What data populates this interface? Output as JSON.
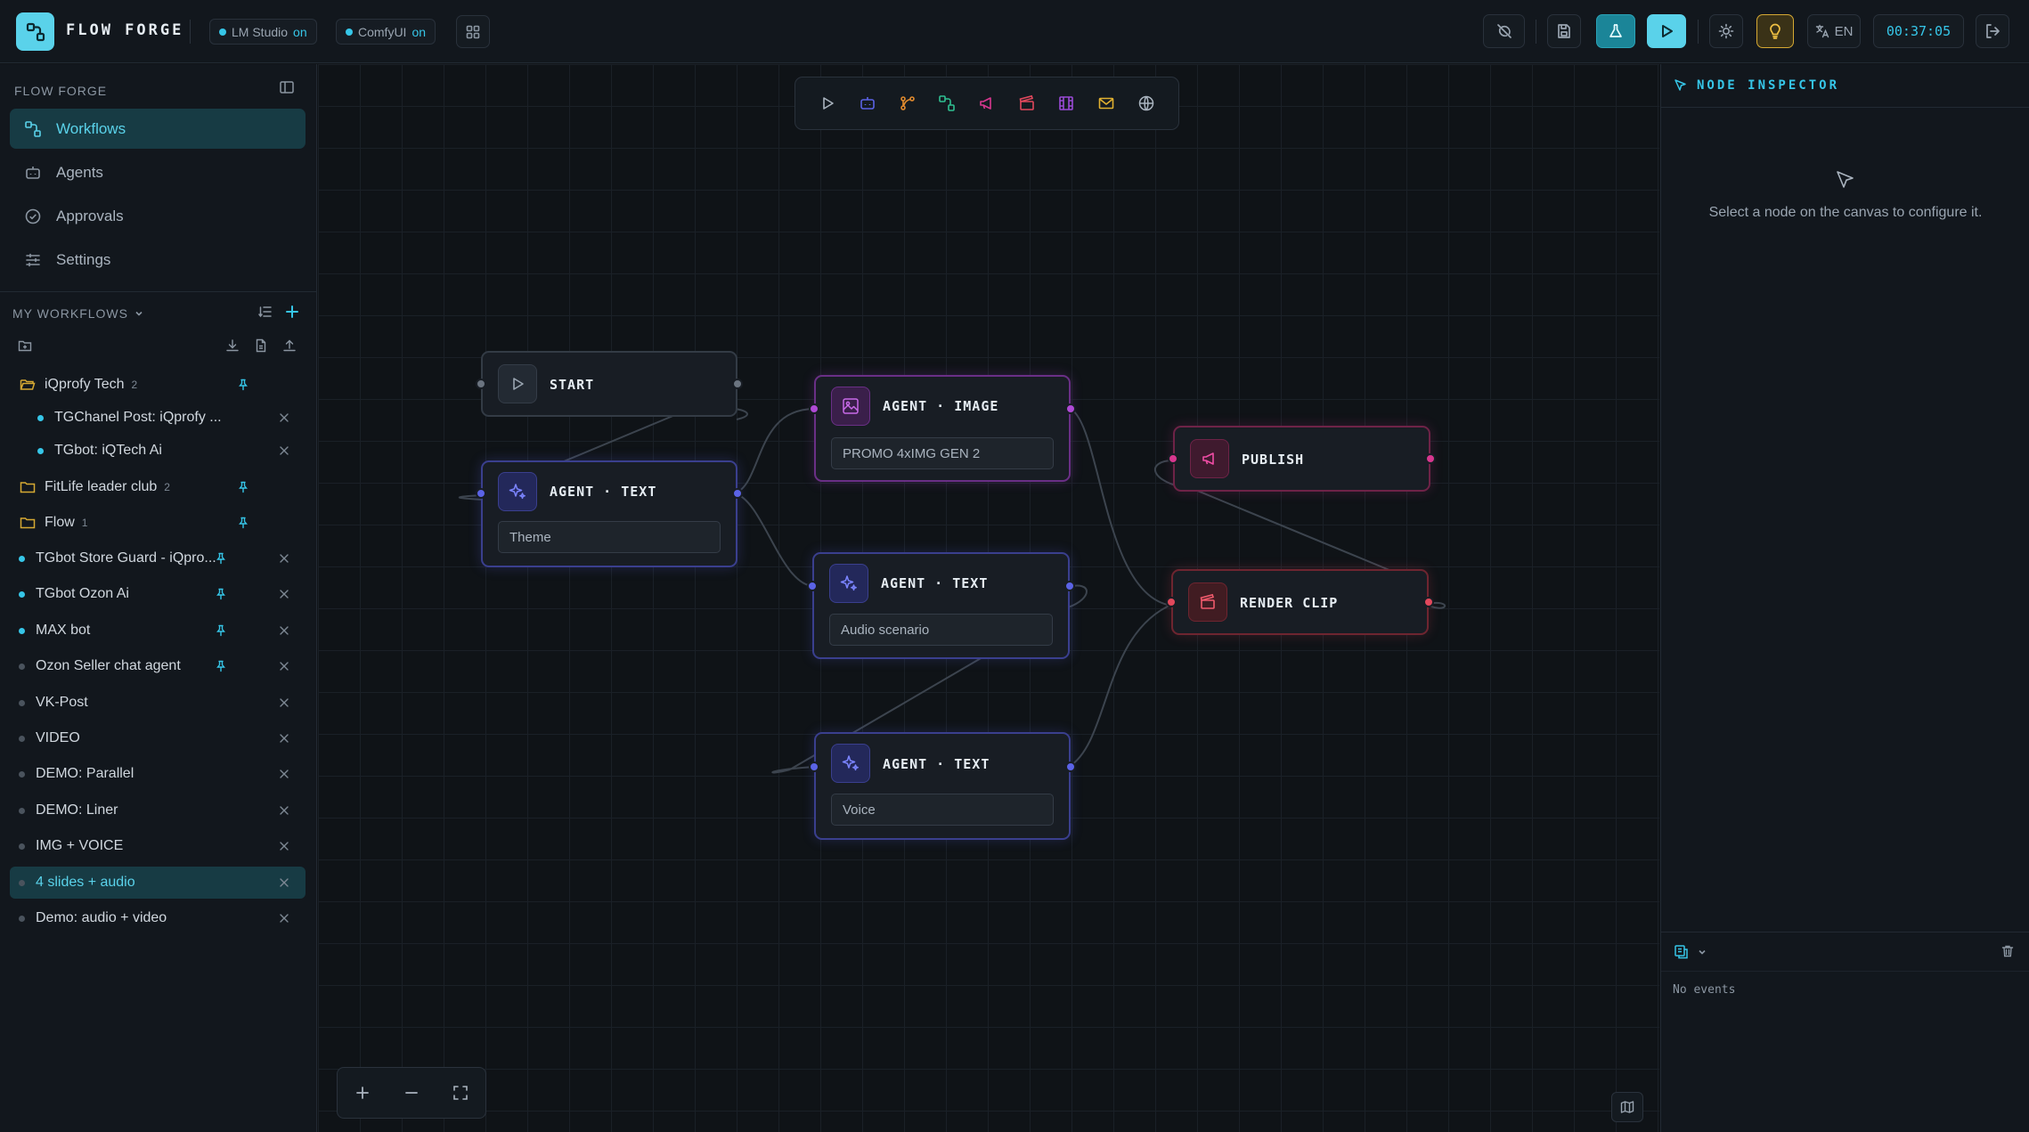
{
  "app": {
    "name": "FLOW FORGE"
  },
  "services": [
    {
      "name": "LM Studio",
      "status": "on"
    },
    {
      "name": "ComfyUI",
      "status": "on"
    }
  ],
  "header": {
    "language": "EN",
    "timer": "00:37:05"
  },
  "sidebar": {
    "heading": "FLOW FORGE",
    "nav": [
      {
        "label": "Workflows",
        "icon": "workflow-icon",
        "active": true
      },
      {
        "label": "Agents",
        "icon": "robot-icon",
        "active": false
      },
      {
        "label": "Approvals",
        "icon": "check-circle-icon",
        "active": false
      },
      {
        "label": "Settings",
        "icon": "sliders-icon",
        "active": false
      }
    ],
    "section_title": "MY WORKFLOWS",
    "folders": [
      {
        "name": "iQprofy Tech",
        "count": "2",
        "children": [
          "TGChanel Post: iQprofy ...",
          "TGbot: iQTech Ai"
        ]
      },
      {
        "name": "FitLife leader club",
        "count": "2"
      },
      {
        "name": "Flow",
        "count": "1"
      }
    ],
    "workflows": [
      {
        "name": "TGbot Store Guard - iQpro...",
        "active": true,
        "pinned": true
      },
      {
        "name": "TGbot Ozon Ai",
        "active": true,
        "pinned": true
      },
      {
        "name": "MAX bot",
        "active": true,
        "pinned": true
      },
      {
        "name": "Ozon Seller chat agent",
        "active": false,
        "pinned": true
      },
      {
        "name": "VK-Post",
        "active": false,
        "pinned": false
      },
      {
        "name": "VIDEO",
        "active": false,
        "pinned": false
      },
      {
        "name": "DEMO: Parallel",
        "active": false,
        "pinned": false
      },
      {
        "name": "DEMO: Liner",
        "active": false,
        "pinned": false
      },
      {
        "name": "IMG + VOICE",
        "active": false,
        "pinned": false
      },
      {
        "name": "4 slides + audio",
        "active": false,
        "pinned": false,
        "selected": true
      },
      {
        "name": "Demo: audio + video",
        "active": false,
        "pinned": false
      }
    ]
  },
  "canvas": {
    "palette": [
      "play-icon",
      "robot-icon",
      "branch-icon",
      "workflow-icon",
      "megaphone-icon",
      "clapperboard-icon",
      "film-icon",
      "mail-icon",
      "globe-icon"
    ],
    "nodes": {
      "start": {
        "title": "START"
      },
      "text_theme": {
        "title": "AGENT · TEXT",
        "field": "Theme"
      },
      "image": {
        "title": "AGENT · IMAGE",
        "field": "PROMO 4xIMG GEN 2"
      },
      "text_audio": {
        "title": "AGENT · TEXT",
        "field": "Audio scenario"
      },
      "text_voice": {
        "title": "AGENT · TEXT",
        "field": "Voice"
      },
      "publish": {
        "title": "PUBLISH"
      },
      "render": {
        "title": "RENDER CLIP"
      }
    },
    "colors": {
      "accent": "#36c6e8",
      "text_agent": "#5b63e6",
      "image_agent": "#b04ad6",
      "publish": "#d8378f",
      "render": "#e2485c"
    }
  },
  "inspector": {
    "title": "NODE INSPECTOR",
    "empty_message": "Select a node on the canvas to configure it.",
    "events_empty": "No events"
  }
}
